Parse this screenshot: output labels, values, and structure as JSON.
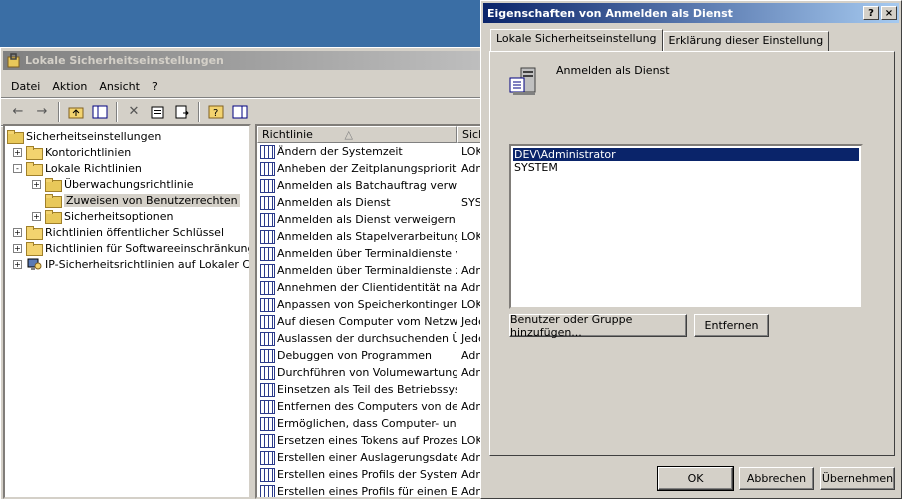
{
  "mmc": {
    "title": "Lokale Sicherheitseinstellungen",
    "menu": [
      "Datei",
      "Aktion",
      "Ansicht",
      "?"
    ],
    "tree": [
      {
        "label": "Sicherheitseinstellungen",
        "level": 0,
        "expander": ""
      },
      {
        "label": "Kontorichtlinien",
        "level": 1,
        "expander": "+"
      },
      {
        "label": "Lokale Richtlinien",
        "level": 1,
        "expander": "-"
      },
      {
        "label": "Überwachungsrichtlinie",
        "level": 2,
        "expander": "+"
      },
      {
        "label": "Zuweisen von Benutzerrechten",
        "level": 2,
        "expander": ""
      },
      {
        "label": "Sicherheitsoptionen",
        "level": 2,
        "expander": "+"
      },
      {
        "label": "Richtlinien öffentlicher Schlüssel",
        "level": 1,
        "expander": "+"
      },
      {
        "label": "Richtlinien für Softwareeinschränkung",
        "level": 1,
        "expander": "+"
      },
      {
        "label": "IP-Sicherheitsrichtlinien auf Lokaler Comp",
        "level": 1,
        "expander": "+"
      }
    ],
    "list_headers": [
      "Richtlinie",
      "Siche"
    ],
    "rows": [
      [
        "Ändern der Systemzeit",
        "LOKA"
      ],
      [
        "Anheben der Zeitplanungspriorität",
        "Admi"
      ],
      [
        "Anmelden als Batchauftrag verwei...",
        ""
      ],
      [
        "Anmelden als Dienst",
        "SYST"
      ],
      [
        "Anmelden als Dienst verweigern",
        ""
      ],
      [
        "Anmelden als Stapelverarbeitungs...",
        "LOKA"
      ],
      [
        "Anmelden über Terminaldienste v...",
        ""
      ],
      [
        "Anmelden über Terminaldienste zu...",
        "Admi"
      ],
      [
        "Annehmen der Clientidentität nac...",
        "Admi"
      ],
      [
        "Anpassen von Speicherkontingent...",
        "LOKA"
      ],
      [
        "Auf diesen Computer vom Netzwe...",
        "Jede"
      ],
      [
        "Auslassen der durchsuchenden Ü...",
        "Jede"
      ],
      [
        "Debuggen von Programmen",
        "Admi"
      ],
      [
        "Durchführen von Volumewartungs...",
        "Admi"
      ],
      [
        "Einsetzen als Teil des Betriebssyst...",
        ""
      ],
      [
        "Entfernen des Computers von der...",
        "Admi"
      ],
      [
        "Ermöglichen, dass Computer- und ...",
        ""
      ],
      [
        "Ersetzen eines Tokens auf Prozes...",
        "LOKA"
      ],
      [
        "Erstellen einer Auslagerungsdatei",
        "Admi"
      ],
      [
        "Erstellen eines Profils der Systeml...",
        "Admi"
      ],
      [
        "Erstellen eines Profils für einen Ein...",
        "Admi"
      ]
    ]
  },
  "dialog": {
    "title": "Eigenschaften von Anmelden als Dienst",
    "help_glyph": "?",
    "close_glyph": "×",
    "tabs": [
      "Lokale Sicherheitseinstellung",
      "Erklärung dieser Einstellung"
    ],
    "policy_name": "Anmelden als Dienst",
    "accounts": [
      "DEV\\Administrator",
      "SYSTEM"
    ],
    "add_button": "Benutzer oder Gruppe hinzufügen...",
    "remove_button": "Entfernen",
    "ok": "OK",
    "cancel": "Abbrechen",
    "apply": "Übernehmen"
  }
}
